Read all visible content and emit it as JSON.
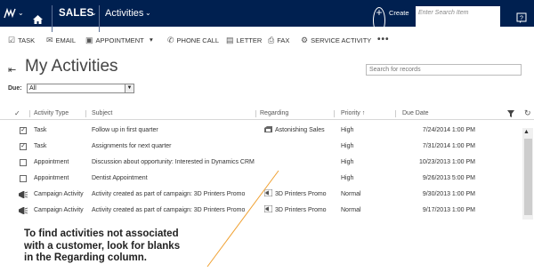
{
  "navbar": {
    "app_name": "SALES",
    "area": "Activities",
    "create_label": "Create",
    "search_placeholder": "Enter Search Item",
    "colors": {
      "background": "#002050",
      "text": "#ffffff"
    }
  },
  "commands": [
    {
      "label": "TASK",
      "icon": "checkbox-icon"
    },
    {
      "label": "EMAIL",
      "icon": "envelope-icon"
    },
    {
      "label": "APPOINTMENT",
      "icon": "calendar-icon"
    },
    {
      "label": "PHONE CALL",
      "icon": "phone-icon"
    },
    {
      "label": "LETTER",
      "icon": "letter-icon"
    },
    {
      "label": "FAX",
      "icon": "fax-icon"
    },
    {
      "label": "SERVICE ACTIVITY",
      "icon": "service-icon"
    }
  ],
  "view": {
    "title": "My Activities",
    "search_placeholder": "Search for records",
    "due_label": "Due:",
    "due_value": "All"
  },
  "grid": {
    "columns": [
      "Activity Type",
      "Subject",
      "Regarding",
      "Priority",
      "Due Date"
    ],
    "sort_column": "Priority",
    "rows": [
      {
        "selected": true,
        "type_icon": "checkbox-icon",
        "type": "Task",
        "subject": "Follow up in first quarter",
        "regarding": "Astonishing Sales",
        "regarding_icon": "opportunity-icon",
        "priority": "High",
        "due": "7/24/2014 1:00 PM"
      },
      {
        "selected": true,
        "type_icon": "checkbox-icon",
        "type": "Task",
        "subject": "Assignments for next quarter",
        "regarding": "",
        "regarding_icon": "",
        "priority": "High",
        "due": "7/31/2014 1:00 PM"
      },
      {
        "selected": false,
        "type_icon": "checkbox-icon",
        "type": "Appointment",
        "subject": "Discussion about opportunity: Interested in Dynamics CRM",
        "regarding": "",
        "regarding_icon": "",
        "priority": "High",
        "due": "10/23/2013 1:00 PM"
      },
      {
        "selected": false,
        "type_icon": "checkbox-icon",
        "type": "Appointment",
        "subject": "Dentist Appointment",
        "regarding": "",
        "regarding_icon": "",
        "priority": "High",
        "due": "9/26/2013 5:00 PM"
      },
      {
        "selected": false,
        "type_icon": "campaign-icon",
        "type": "Campaign Activity",
        "subject": "Activity created as part of campaign: 3D Printers Promo",
        "regarding": "3D Printers Promo",
        "regarding_icon": "campaign-icon",
        "priority": "Normal",
        "due": "9/30/2013 1:00 PM"
      },
      {
        "selected": false,
        "type_icon": "campaign-icon",
        "type": "Campaign Activity",
        "subject": "Activity created as part of campaign: 3D Printers Promo",
        "regarding": "3D Printers Promo",
        "regarding_icon": "campaign-icon",
        "priority": "Normal",
        "due": "9/17/2013 1:00 PM"
      }
    ]
  },
  "annotation": {
    "lines": [
      "To find activities not associated",
      "with a customer, look for blanks",
      "in the Regarding column."
    ],
    "colors": {
      "line": "#f0a030"
    }
  }
}
